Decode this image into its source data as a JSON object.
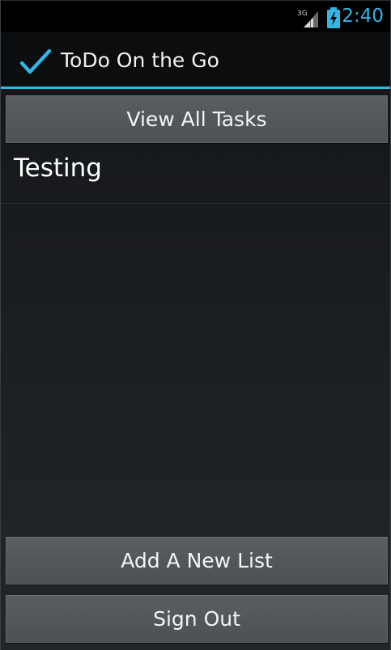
{
  "status_bar": {
    "network": "3G",
    "time": "2:40",
    "accent_color": "#33b5e5"
  },
  "action_bar": {
    "icon": "checkmark-icon",
    "title": "ToDo On the Go"
  },
  "buttons": {
    "view_all_label": "View All Tasks",
    "add_list_label": "Add A New List",
    "sign_out_label": "Sign Out"
  },
  "lists": [
    {
      "name": "Testing"
    }
  ]
}
